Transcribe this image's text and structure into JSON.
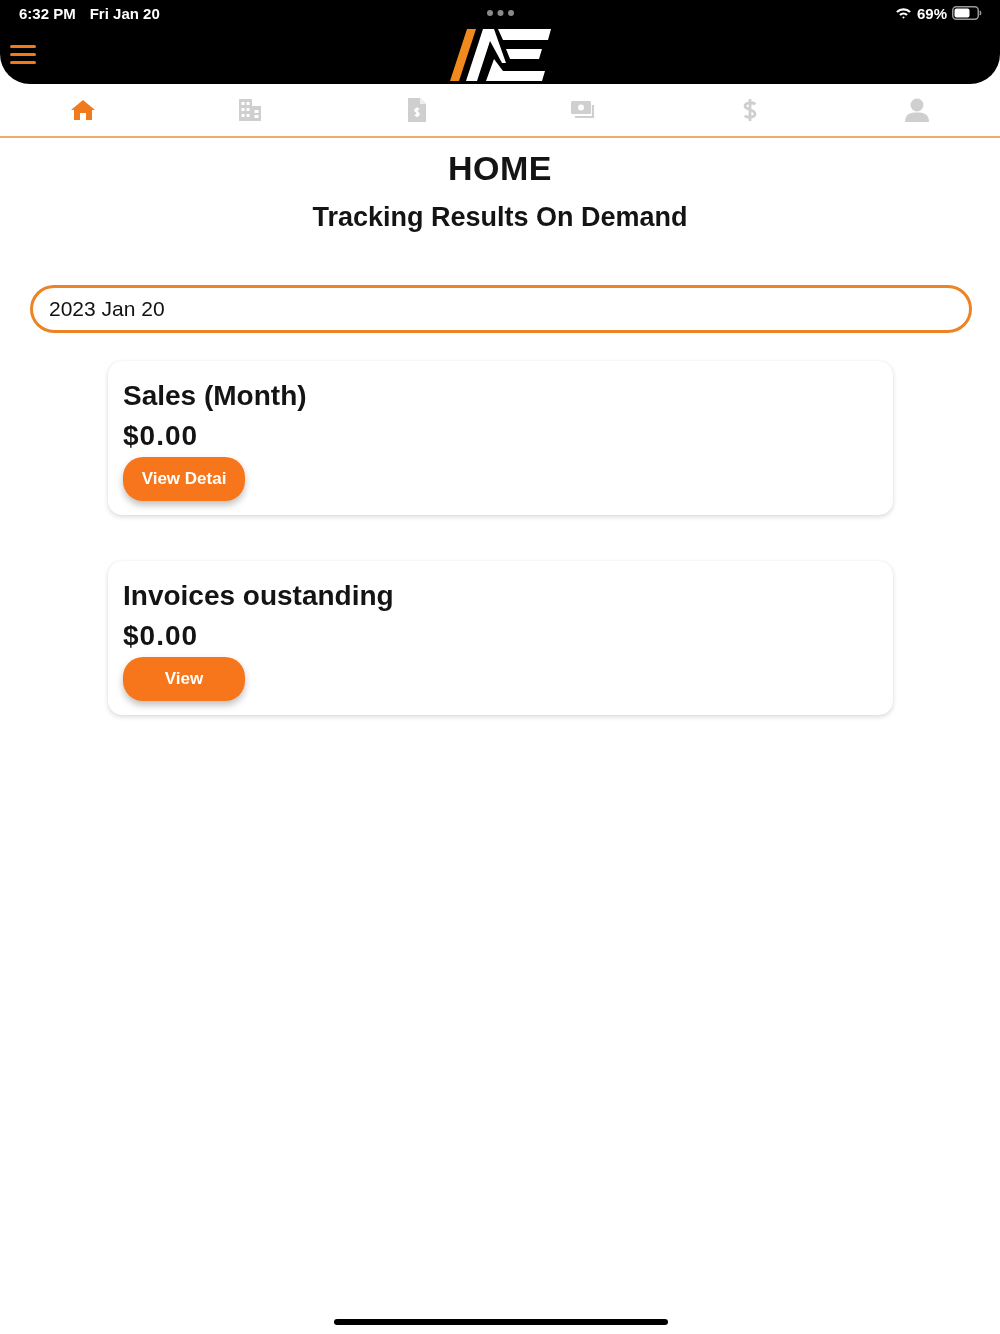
{
  "status_bar": {
    "time": "6:32 PM",
    "date": "Fri Jan 20",
    "battery": "69%"
  },
  "tabs": [
    {
      "kind": "home",
      "selected": true
    },
    {
      "kind": "building",
      "selected": false
    },
    {
      "kind": "invoice",
      "selected": false
    },
    {
      "kind": "cash",
      "selected": false
    },
    {
      "kind": "dollar",
      "selected": false
    },
    {
      "kind": "person",
      "selected": false
    }
  ],
  "page": {
    "title": "HOME",
    "subtitle": "Tracking Results On Demand"
  },
  "date_field": {
    "value": "2023 Jan 20"
  },
  "cards": [
    {
      "title": "Sales (Month)",
      "amount": "$0.00",
      "button": "View Detai"
    },
    {
      "title": "Invoices oustanding",
      "amount": "$0.00",
      "button": "View"
    }
  ]
}
